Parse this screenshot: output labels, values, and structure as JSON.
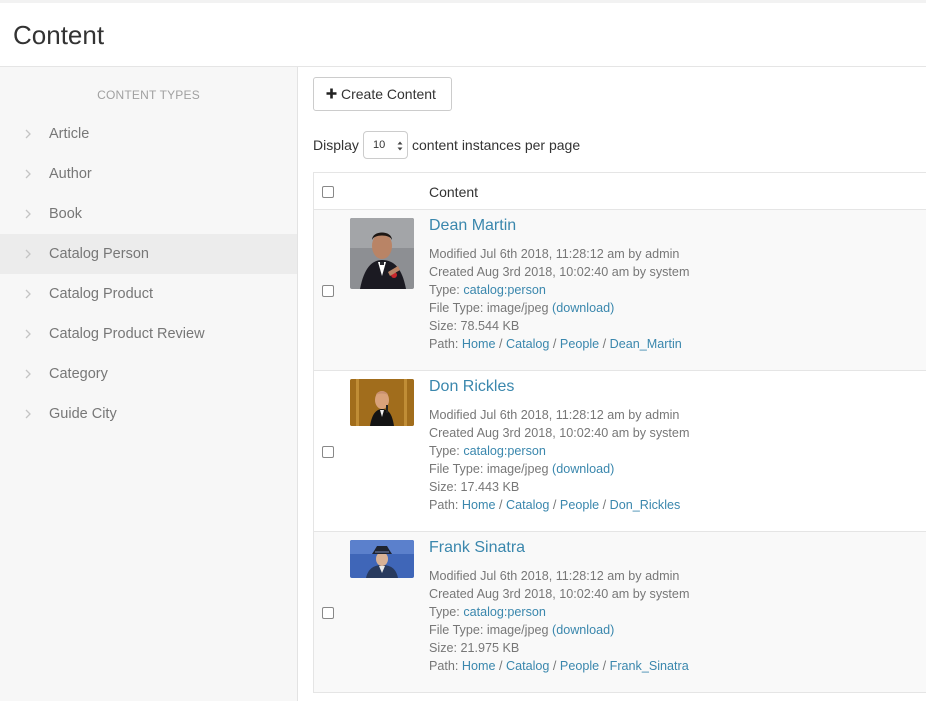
{
  "page": {
    "title": "Content"
  },
  "sidebar": {
    "heading": "CONTENT TYPES",
    "items": [
      {
        "label": "Article",
        "active": false
      },
      {
        "label": "Author",
        "active": false
      },
      {
        "label": "Book",
        "active": false
      },
      {
        "label": "Catalog Person",
        "active": true
      },
      {
        "label": "Catalog Product",
        "active": false
      },
      {
        "label": "Catalog Product Review",
        "active": false
      },
      {
        "label": "Category",
        "active": false
      },
      {
        "label": "Guide City",
        "active": false
      }
    ]
  },
  "toolbar": {
    "create_label": "Create Content"
  },
  "pagination": {
    "prefix": "Display",
    "per_page": "10",
    "suffix": "content instances per page"
  },
  "table": {
    "header": "Content",
    "labels": {
      "type": "Type:",
      "file_type": "File Type:",
      "download": "(download)",
      "size": "Size:",
      "path": "Path:"
    },
    "rows": [
      {
        "title": "Dean Martin",
        "modified": "Modified Jul 6th 2018, 11:28:12 am by admin",
        "created": "Created Aug 3rd 2018, 10:02:40 am by system",
        "type": "catalog:person",
        "file_type": "image/jpeg",
        "size": "78.544 KB",
        "path": [
          "Home",
          "Catalog",
          "People",
          "Dean_Martin"
        ]
      },
      {
        "title": "Don Rickles",
        "modified": "Modified Jul 6th 2018, 11:28:12 am by admin",
        "created": "Created Aug 3rd 2018, 10:02:40 am by system",
        "type": "catalog:person",
        "file_type": "image/jpeg",
        "size": "17.443 KB",
        "path": [
          "Home",
          "Catalog",
          "People",
          "Don_Rickles"
        ]
      },
      {
        "title": "Frank Sinatra",
        "modified": "Modified Jul 6th 2018, 11:28:12 am by admin",
        "created": "Created Aug 3rd 2018, 10:02:40 am by system",
        "type": "catalog:person",
        "file_type": "image/jpeg",
        "size": "21.975 KB",
        "path": [
          "Home",
          "Catalog",
          "People",
          "Frank_Sinatra"
        ]
      }
    ]
  },
  "colors": {
    "link": "#3a87ad",
    "muted": "#777777",
    "active_row": "#ececec"
  }
}
